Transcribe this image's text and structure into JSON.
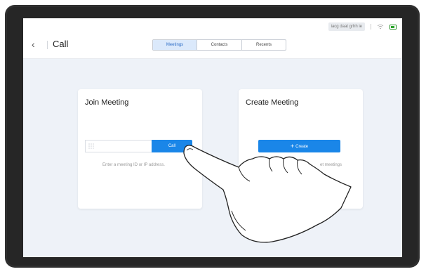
{
  "status_bar": {
    "chip": "iacg daat grhh ie"
  },
  "header": {
    "back_glyph": "‹",
    "title": "Call"
  },
  "tabs": [
    {
      "label": "Meetings",
      "active": true
    },
    {
      "label": "Contacts",
      "active": false
    },
    {
      "label": "Recents",
      "active": false
    }
  ],
  "join_card": {
    "title": "Join Meeting",
    "call_label": "Call",
    "hint": "Enter a meeting ID or IP address."
  },
  "create_card": {
    "title": "Create Meeting",
    "create_label": "Create",
    "plus_glyph": "+",
    "hint_partial": "et meetings"
  },
  "colors": {
    "accent": "#1a86e8",
    "screen_bg": "#eef2f8",
    "device": "#2f2f2f"
  },
  "icons": [
    "chevron-left-icon",
    "dialpad-icon",
    "plus-icon",
    "wifi-icon",
    "battery-icon",
    "pointing-hand-icon"
  ]
}
